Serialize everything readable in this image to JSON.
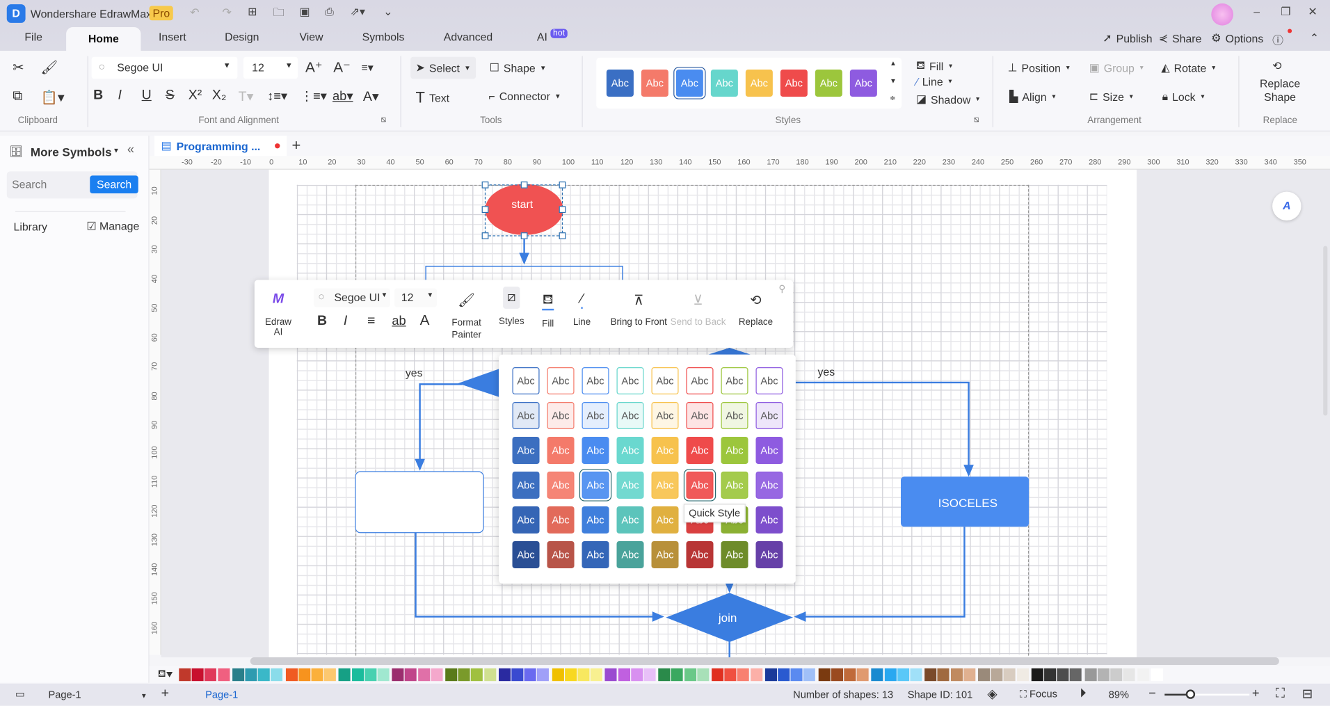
{
  "app": {
    "title": "Wondershare EdrawMax",
    "badge": "Pro"
  },
  "menu": {
    "tabs": [
      "File",
      "Home",
      "Insert",
      "Design",
      "View",
      "Symbols",
      "Advanced",
      "AI"
    ],
    "ai_badge": "hot",
    "active": "Home"
  },
  "top_right": {
    "publish": "Publish",
    "share": "Share",
    "options": "Options"
  },
  "ribbon": {
    "font_name": "Segoe UI",
    "font_size": "12",
    "groups": {
      "clipboard": "Clipboard",
      "font": "Font and Alignment",
      "tools": "Tools",
      "styles": "Styles",
      "arrangement": "Arrangement",
      "replace": "Replace"
    },
    "tools": {
      "select": "Select",
      "shape": "Shape",
      "text": "Text",
      "connector": "Connector"
    },
    "styles_label": "Abc",
    "style_colors": [
      "#3a6fc4",
      "#f47a6a",
      "#4a8cf0",
      "#66d6cc",
      "#f7c24d",
      "#ef4b4b",
      "#9cc63c",
      "#8e5be0"
    ],
    "fill": "Fill",
    "line": "Line",
    "shadow": "Shadow",
    "position": "Position",
    "group": "Group",
    "rotate": "Rotate",
    "align": "Align",
    "size": "Size",
    "lock": "Lock",
    "replace_shape": "Replace Shape"
  },
  "sidebar": {
    "title": "More Symbols",
    "search_placeholder": "Search",
    "search_button": "Search",
    "library": "Library",
    "manage": "Manage"
  },
  "doc": {
    "tab": "Programming ..."
  },
  "ruler": {
    "h": [
      "-30",
      "-20",
      "-10",
      "0",
      "10",
      "20",
      "30",
      "40",
      "50",
      "60",
      "70",
      "80",
      "90",
      "100",
      "110",
      "120",
      "130",
      "140",
      "150",
      "160",
      "170",
      "180",
      "190",
      "200",
      "210",
      "220",
      "230",
      "240",
      "250",
      "260",
      "270",
      "280",
      "290",
      "300",
      "310",
      "320",
      "330",
      "340",
      "350"
    ],
    "v": [
      "10",
      "20",
      "30",
      "40",
      "50",
      "60",
      "70",
      "80",
      "90",
      "100",
      "110",
      "120",
      "130",
      "140",
      "150",
      "160"
    ]
  },
  "floating_toolbar": {
    "edraw_ai": "Edraw AI",
    "font": "Segoe UI",
    "size": "12",
    "format_painter": "Format Painter",
    "styles": "Styles",
    "fill": "Fill",
    "line": "Line",
    "bring_front": "Bring to Front",
    "send_back": "Send to Back",
    "replace": "Replace"
  },
  "quick_style": {
    "label": "Abc",
    "tooltip": "Quick Style",
    "base": [
      "#3a6fc4",
      "#f47a6a",
      "#4a8cf0",
      "#66d6cc",
      "#f7c24d",
      "#ef4b4b",
      "#9cc63c",
      "#8e5be0"
    ],
    "r3": [
      "#3c6fc0",
      "#f47a6a",
      "#4a8cf0",
      "#6ad8cf",
      "#f7c24d",
      "#ef4b4b",
      "#9cc63c",
      "#8e5be0"
    ],
    "r5": [
      "#3565b5",
      "#e26a5a",
      "#3f7fdc",
      "#5cc4bb",
      "#e0b040",
      "#d94040",
      "#8bb033",
      "#7d4ecc"
    ],
    "r6": [
      "#2a4f95",
      "#b85448",
      "#3466b8",
      "#4aa39b",
      "#b8903a",
      "#b83535",
      "#6e8c2a",
      "#6640a8"
    ]
  },
  "diagram": {
    "start": "start",
    "yes_left": "yes",
    "yes_right": "yes",
    "isoceles": "ISOCELES",
    "join": "join"
  },
  "palette": [
    "#c0392b",
    "#c8102e",
    "#e0395a",
    "#f06080",
    "#2a7f8a",
    "#2e9bb0",
    "#3ab8c8",
    "#8adcea",
    "#f05a22",
    "#f7931e",
    "#fbb03b",
    "#fcc870",
    "#16a085",
    "#1abc9c",
    "#48d1b0",
    "#a0e8d0",
    "#9b2d6e",
    "#c0458a",
    "#e070a8",
    "#f4a8cc",
    "#5a7a1a",
    "#7a9a2a",
    "#a0c040",
    "#d0e090",
    "#2a2aa0",
    "#3a4ad0",
    "#6a6af0",
    "#a0a0f8",
    "#f0c000",
    "#f8d820",
    "#f8e860",
    "#f8f090",
    "#9a4ad0",
    "#c060e0",
    "#d890f0",
    "#e8c0f8",
    "#2a8a4a",
    "#3aa860",
    "#6ac888",
    "#a8e0b8",
    "#e03020",
    "#f05040",
    "#f88070",
    "#fcb0a8",
    "#1a3a9a",
    "#2a5ad0",
    "#5a8af0",
    "#a0c0f8",
    "#7a3a10",
    "#9a4a20",
    "#c06a3a",
    "#e09a70",
    "#1a8ad0",
    "#2aa8f0",
    "#5ac8f8",
    "#a0e0f8",
    "#7a4a2a",
    "#a06a40",
    "#c08a60",
    "#e0b090",
    "#9a8a7a",
    "#b8a898",
    "#d8ccc0",
    "#f0ebe4",
    "#1a1a1a",
    "#333333",
    "#4d4d4d",
    "#666666",
    "#999999",
    "#b3b3b3",
    "#cccccc",
    "#e6e6e6",
    "#f2f2f2",
    "#ffffff"
  ],
  "status": {
    "page_sel": "Page-1",
    "page_tab": "Page-1",
    "shapes": "Number of shapes: 13",
    "shape_id": "Shape ID: 101",
    "focus": "Focus",
    "zoom": "89%",
    "zoom_level": 0.3
  }
}
